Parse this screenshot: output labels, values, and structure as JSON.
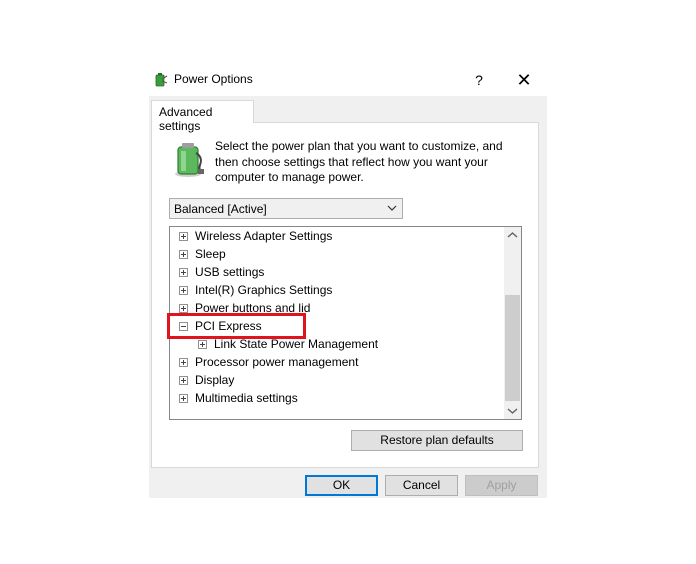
{
  "window": {
    "title": "Power Options",
    "help_glyph": "?",
    "close_glyph": "✕"
  },
  "tabs": [
    {
      "label": "Advanced settings",
      "selected": true
    }
  ],
  "description": "Select the power plan that you want to customize, and then choose settings that reflect how you want your computer to manage power.",
  "plan_select": {
    "value": "Balanced [Active]"
  },
  "tree": {
    "items": [
      {
        "label": "Wireless Adapter Settings",
        "expanded": false,
        "level": 0
      },
      {
        "label": "Sleep",
        "expanded": false,
        "level": 0
      },
      {
        "label": "USB settings",
        "expanded": false,
        "level": 0
      },
      {
        "label": "Intel(R) Graphics Settings",
        "expanded": false,
        "level": 0
      },
      {
        "label": "Power buttons and lid",
        "expanded": false,
        "level": 0
      },
      {
        "label": "PCI Express",
        "expanded": true,
        "level": 0,
        "highlighted": true
      },
      {
        "label": "Link State Power Management",
        "expanded": false,
        "level": 1
      },
      {
        "label": "Processor power management",
        "expanded": false,
        "level": 0
      },
      {
        "label": "Display",
        "expanded": false,
        "level": 0
      },
      {
        "label": "Multimedia settings",
        "expanded": false,
        "level": 0
      }
    ]
  },
  "buttons": {
    "restore": "Restore plan defaults",
    "ok": "OK",
    "cancel": "Cancel",
    "apply": "Apply"
  },
  "colors": {
    "highlight": "#e0141e",
    "focus_border": "#0078d7"
  }
}
